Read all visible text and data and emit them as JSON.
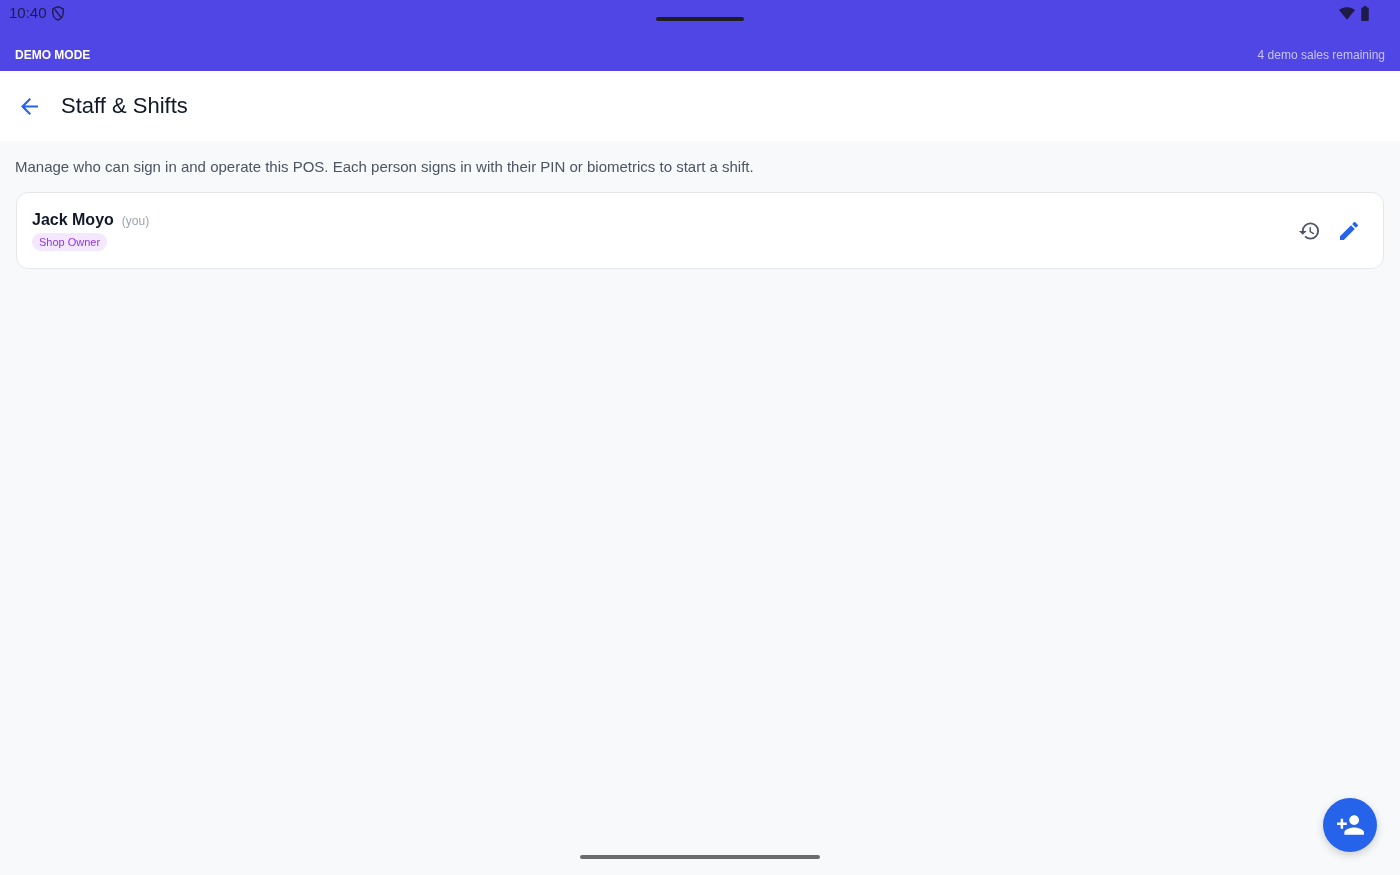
{
  "status_bar": {
    "time": "10:40"
  },
  "demo_banner": {
    "label": "DEMO MODE",
    "remaining": "4 demo sales remaining"
  },
  "app_bar": {
    "title": "Staff & Shifts"
  },
  "description": "Manage who can sign in and operate this POS. Each person signs in with their PIN or biometrics to start a shift.",
  "staff": [
    {
      "name": "Jack Moyo",
      "note": "(you)",
      "role": "Shop Owner"
    }
  ]
}
